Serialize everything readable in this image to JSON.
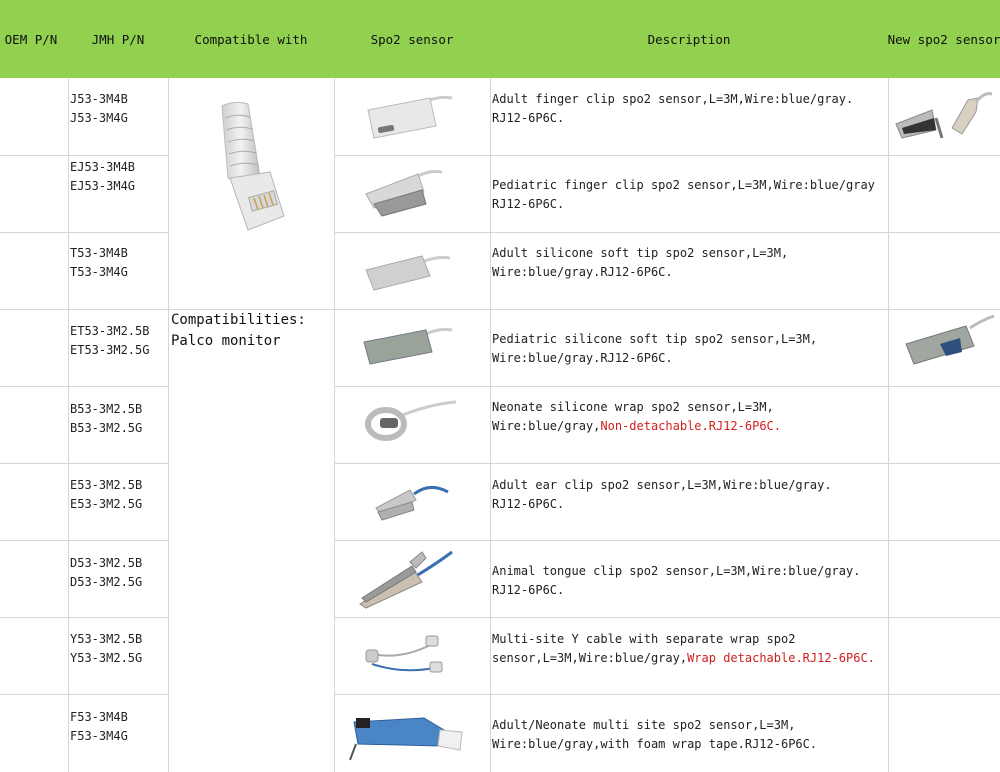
{
  "header": {
    "oem_pn": "OEM P/N",
    "jmh_pn": "JMH P/N",
    "compatible_with": "Compatible with",
    "spo2_sensor": "Spo2 sensor",
    "description": "Description",
    "new_spo2_sensor": "New spo2 sensor"
  },
  "compatibility": {
    "line1": "Compatibilities:",
    "line2": "Palco monitor"
  },
  "rows": [
    {
      "pn1": "J53-3M4B",
      "pn2": "J53-3M4G",
      "desc1": "Adult finger clip spo2 sensor,L=3M,Wire:blue/gray.",
      "desc2": "RJ12-6P6C.",
      "desc2_red": ""
    },
    {
      "pn1": "EJ53-3M4B",
      "pn2": "EJ53-3M4G",
      "desc1": "Pediatric finger clip spo2 sensor,L=3M,Wire:blue/gray",
      "desc2": "RJ12-6P6C.",
      "desc2_red": ""
    },
    {
      "pn1": "T53-3M4B",
      "pn2": "T53-3M4G",
      "desc1": "Adult silicone soft tip spo2 sensor,L=3M,",
      "desc2": "Wire:blue/gray.RJ12-6P6C.",
      "desc2_red": ""
    },
    {
      "pn1": "ET53-3M2.5B",
      "pn2": "ET53-3M2.5G",
      "desc1": "Pediatric silicone soft tip spo2 sensor,L=3M,",
      "desc2": "Wire:blue/gray.RJ12-6P6C.",
      "desc2_red": ""
    },
    {
      "pn1": "B53-3M2.5B",
      "pn2": "B53-3M2.5G",
      "desc1": "Neonate silicone wrap spo2 sensor,L=3M,",
      "desc2": "Wire:blue/gray,",
      "desc2_red": "Non-detachable.RJ12-6P6C."
    },
    {
      "pn1": "E53-3M2.5B",
      "pn2": "E53-3M2.5G",
      "desc1": "Adult ear clip spo2 sensor,L=3M,Wire:blue/gray.",
      "desc2": "RJ12-6P6C.",
      "desc2_red": ""
    },
    {
      "pn1": "D53-3M2.5B",
      "pn2": "D53-3M2.5G",
      "desc1": "Animal tongue clip spo2 sensor,L=3M,Wire:blue/gray.",
      "desc2": "RJ12-6P6C.",
      "desc2_red": ""
    },
    {
      "pn1": "Y53-3M2.5B",
      "pn2": "Y53-3M2.5G",
      "desc1": "Multi-site Y cable with separate wrap spo2",
      "desc2": "sensor,L=3M,Wire:blue/gray,",
      "desc2_red": "Wrap detachable.RJ12-6P6C."
    },
    {
      "pn1": "F53-3M4B",
      "pn2": "F53-3M4G",
      "desc1": "Adult/Neonate multi site spo2 sensor,L=3M,",
      "desc2": "Wire:blue/gray,with foam wrap tape.RJ12-6P6C.",
      "desc2_red": ""
    }
  ],
  "colors": {
    "header_bg": "#92d050",
    "grid_line": "#d6d6d6",
    "highlight_text": "#d11e1e"
  }
}
